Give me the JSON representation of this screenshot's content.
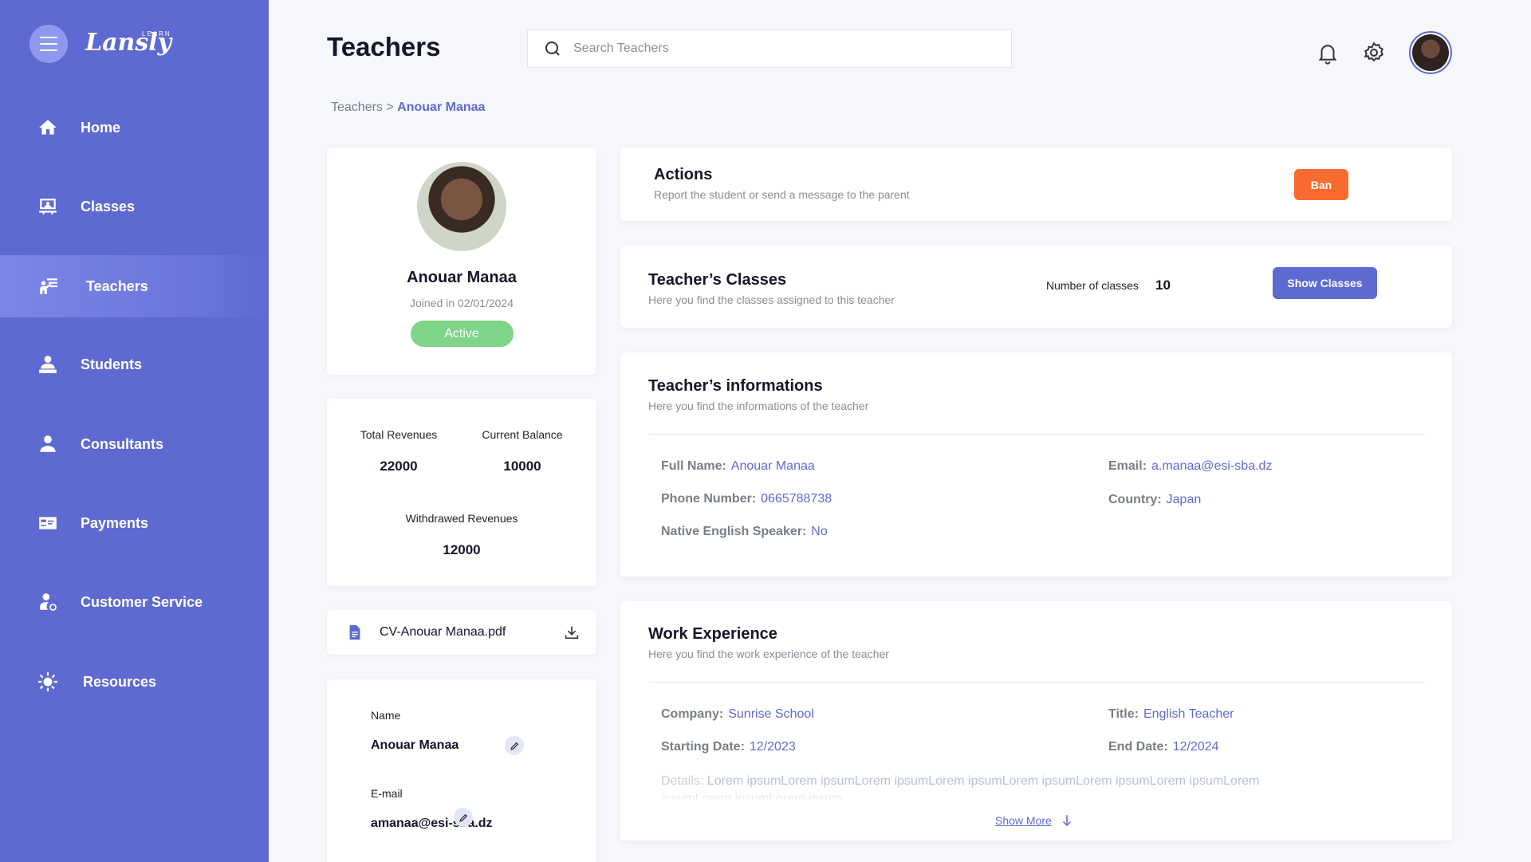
{
  "app": {
    "logo": "Lansly",
    "logo_sub": "LEARN"
  },
  "sidebar": {
    "items": [
      {
        "label": "Home",
        "icon": "home-icon",
        "active": false
      },
      {
        "label": "Classes",
        "icon": "classes-icon",
        "active": false
      },
      {
        "label": "Teachers",
        "icon": "teachers-icon",
        "active": true
      },
      {
        "label": "Students",
        "icon": "students-icon",
        "active": false
      },
      {
        "label": "Consultants",
        "icon": "consultants-icon",
        "active": false
      },
      {
        "label": "Payments",
        "icon": "payments-icon",
        "active": false
      },
      {
        "label": "Customer Service",
        "icon": "customer-service-icon",
        "active": false
      },
      {
        "label": "Resources",
        "icon": "resources-icon",
        "active": false
      }
    ]
  },
  "header": {
    "title": "Teachers",
    "search_placeholder": "Search Teachers"
  },
  "breadcrumb": {
    "parent": "Teachers",
    "separator": ">",
    "current": "Anouar Manaa"
  },
  "profile": {
    "name": "Anouar Manaa",
    "joined": "Joined in 02/01/2024",
    "status": "Active"
  },
  "stats": {
    "total_revenues_label": "Total Revenues",
    "total_revenues": "22000",
    "current_balance_label": "Current Balance",
    "current_balance": "10000",
    "withdrawed_label": "Withdrawed Revenues",
    "withdrawed": "12000"
  },
  "cv": {
    "filename": "CV-Anouar Manaa.pdf"
  },
  "account": {
    "name_label": "Name",
    "name_value": "Anouar Manaa",
    "email_label": "E-mail",
    "email_value": "amanaa@esi-sba.dz"
  },
  "actions": {
    "title": "Actions",
    "subtitle": "Report the student or send a message to the parent",
    "ban_label": "Ban"
  },
  "classes": {
    "title": "Teacher’s Classes",
    "subtitle": "Here you find the classes assigned to this teacher",
    "count_label": "Number of classes",
    "count": "10",
    "button_label": "Show Classes"
  },
  "teacher_info": {
    "title": "Teacher’s informations",
    "subtitle": "Here you find the informations of the teacher",
    "full_name_label": "Full Name:",
    "full_name": "Anouar Manaa",
    "email_label": "Email:",
    "email": "a.manaa@esi-sba.dz",
    "phone_label": "Phone Number:",
    "phone": "0665788738",
    "country_label": "Country:",
    "country": "Japan",
    "native_label": "Native English Speaker:",
    "native": "No"
  },
  "work": {
    "title": "Work Experience",
    "subtitle": "Here you find the work experience of the teacher",
    "company_label": "Company:",
    "company": "Sunrise School",
    "job_title_label": "Title:",
    "job_title": "English Teacher",
    "start_label": "Starting Date:",
    "start": "12/2023",
    "end_label": "End Date:",
    "end": "12/2024",
    "details_label": "Details:",
    "details": "Lorem ipsumLorem ipsumLorem ipsumLorem ipsumLorem ipsumLorem ipsumLorem ipsumLorem ipsumLorem ipsumLorem ipsum",
    "show_more": "Show More"
  },
  "colors": {
    "primary": "#5E6AD2",
    "ban": "#F96A2F",
    "active": "#7ED487"
  }
}
